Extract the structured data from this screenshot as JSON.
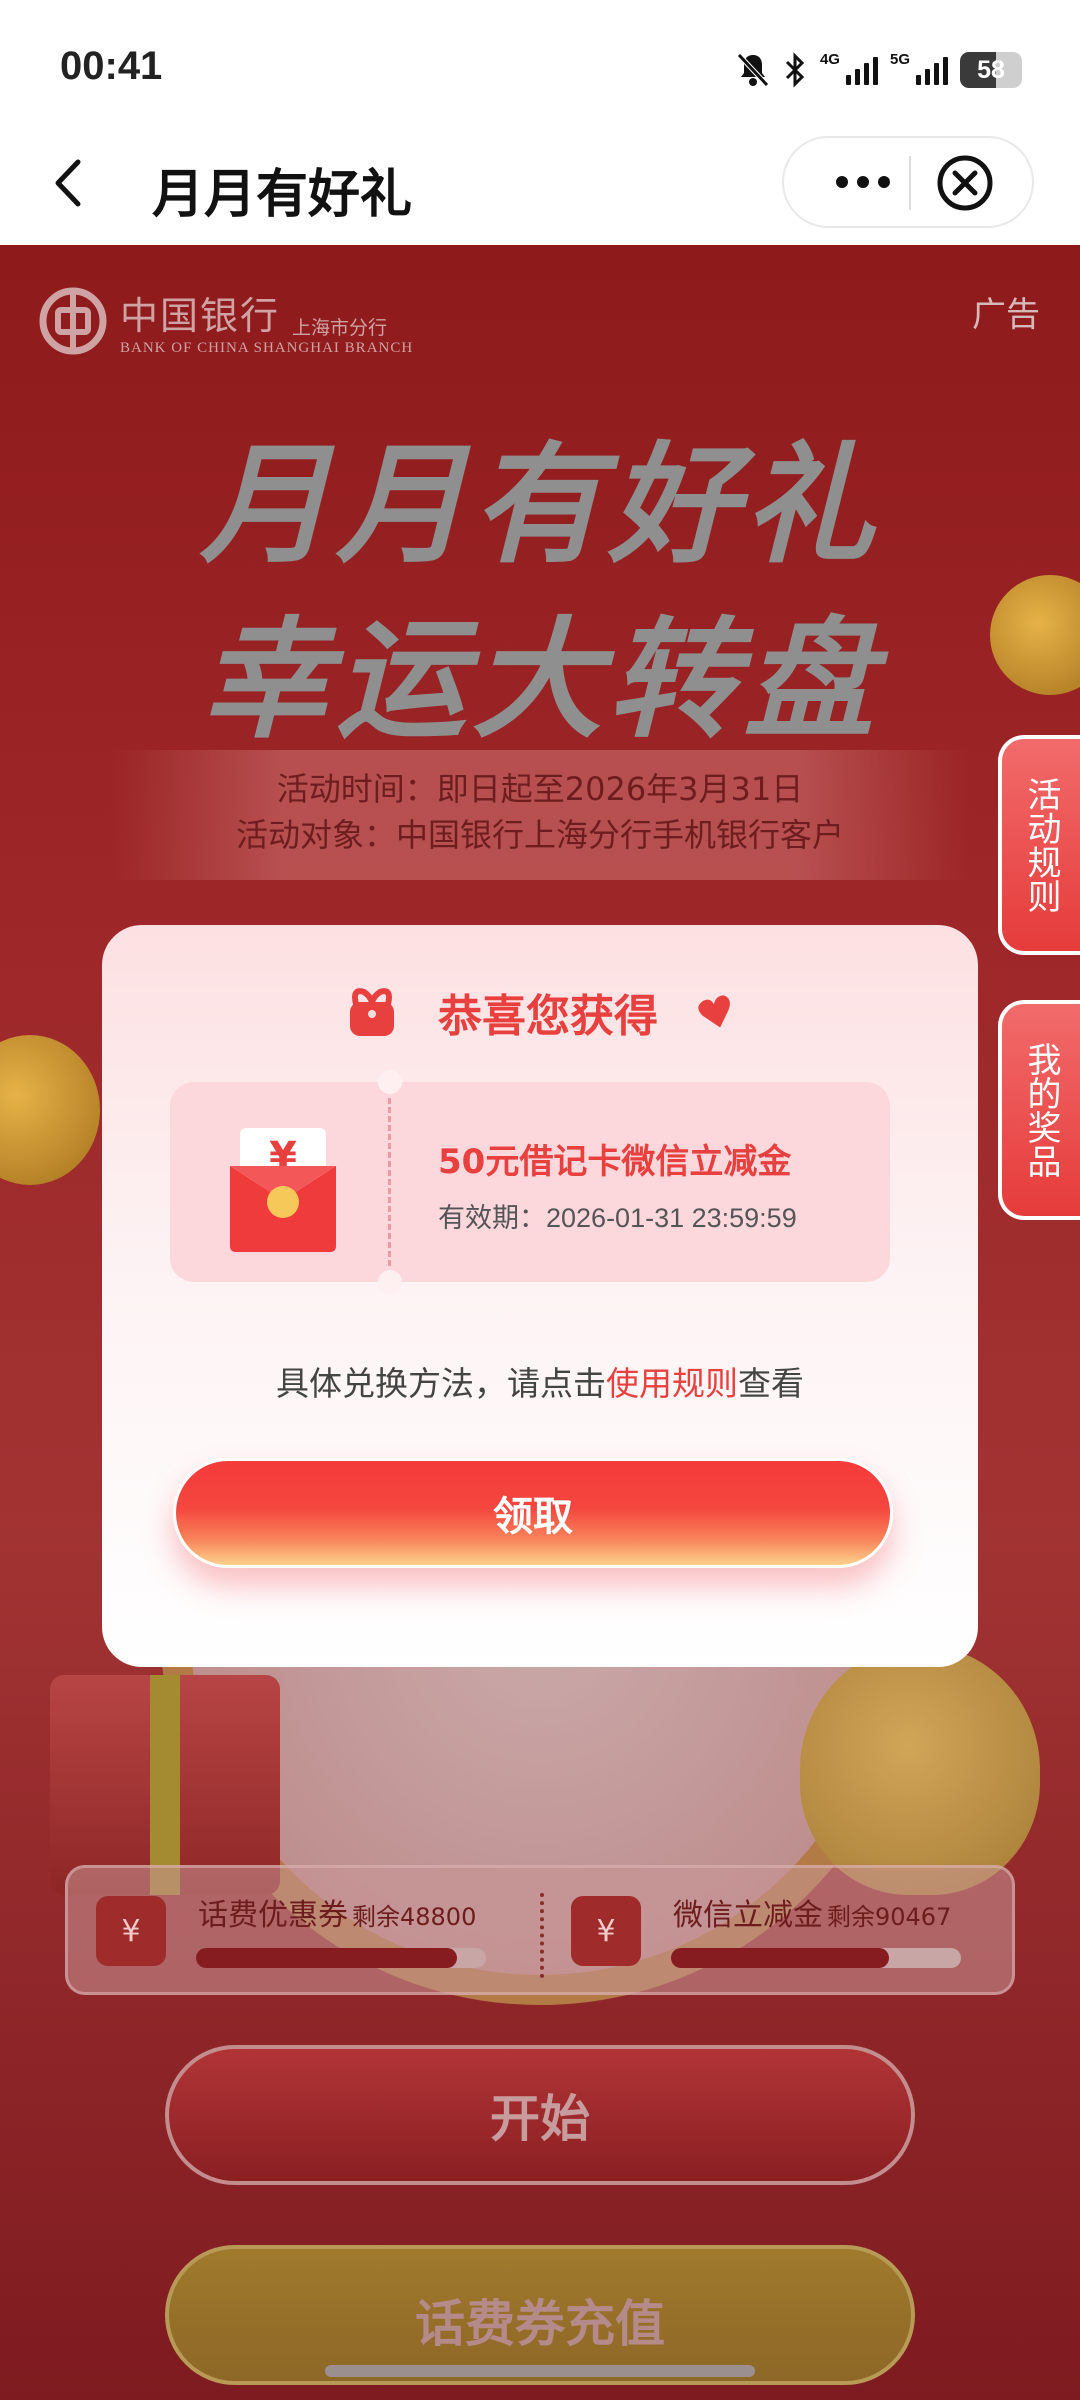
{
  "status_bar": {
    "time": "00:41",
    "net1": "4G",
    "net2": "5G",
    "battery": "58"
  },
  "nav": {
    "title": "月月有好礼"
  },
  "page": {
    "bank_name_cn": "中国银行",
    "bank_branch_cn": "上海市分行",
    "bank_name_en": "BANK OF CHINA   SHANGHAI BRANCH",
    "ad_label": "广告",
    "title_line1": "月月有好礼",
    "title_line2": "幸运大转盘",
    "event_time": "活动时间：即日起至2026年3月31日",
    "event_target": "活动对象：中国银行上海分行手机银行客户",
    "side_tabs": {
      "rules": "活动规则",
      "prizes": "我的奖品"
    },
    "stock": [
      {
        "name": "话费优惠券",
        "remaining": "剩余48800",
        "fill_fraction": 0.9
      },
      {
        "name": "微信立减金",
        "remaining": "剩余90467",
        "fill_fraction": 0.75
      }
    ],
    "start_label": "开始",
    "recharge_label": "话费券充值"
  },
  "modal": {
    "title": "恭喜您获得",
    "coupon": {
      "name": "50元借记卡微信立减金",
      "expiry_label": "有效期：",
      "expiry_value": "2026-01-31 23:59:59",
      "currency_symbol": "¥"
    },
    "note_prefix": "具体兑换方法，请点击",
    "note_link": "使用规则",
    "note_suffix": "查看",
    "claim_label": "领取"
  },
  "colors": {
    "accent_red": "#e8403f",
    "page_bg": "#9d2628"
  }
}
